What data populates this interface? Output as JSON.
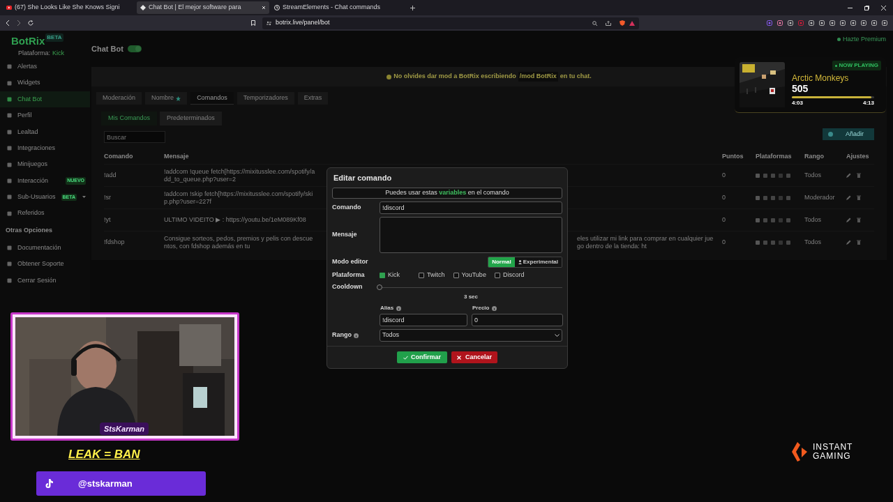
{
  "browser": {
    "tabs": [
      {
        "title": "(67) She Looks Like She Knows Signi",
        "selected": false,
        "kind": "video"
      },
      {
        "title": "Chat Bot | El mejor software para",
        "selected": true,
        "kind": "bot"
      },
      {
        "title": "StreamElements - Chat commands",
        "selected": false,
        "kind": "stream"
      }
    ],
    "url": "botrix.live/panel/bot"
  },
  "sidebar": {
    "logo": "BotRix",
    "beta": "BETA",
    "platform_label": "Plataforma:",
    "platform_value": "Kick",
    "items": [
      {
        "label": "Alertas",
        "selected": false
      },
      {
        "label": "Widgets",
        "selected": false
      },
      {
        "label": "Chat Bot",
        "selected": true
      },
      {
        "label": "Perfil",
        "selected": false
      },
      {
        "label": "Lealtad",
        "selected": false
      },
      {
        "label": "Integraciones",
        "selected": false
      },
      {
        "label": "Minijuegos",
        "selected": false
      },
      {
        "label": "Interacción",
        "selected": false,
        "badge": "NUEVO"
      },
      {
        "label": "Sub-Usuarios",
        "selected": false,
        "badge": "BETA",
        "expandable": true
      },
      {
        "label": "Referidos",
        "selected": false
      }
    ],
    "section_title": "Otras Opciones",
    "extra_items": [
      {
        "label": "Documentación",
        "selected": false
      },
      {
        "label": "Obtener Soporte",
        "selected": false
      },
      {
        "label": "Cerrar Sesión",
        "selected": false
      }
    ]
  },
  "premium_link": "Hazte Premium",
  "header": {
    "title": "Chat Bot",
    "bot_enabled": true
  },
  "banner": {
    "before": "No olvides dar mod a BotRix escribiendo",
    "command": "/mod BotRix",
    "after": "en tu chat."
  },
  "tabs": [
    {
      "label": "Moderación",
      "selected": false
    },
    {
      "label": "Nombre",
      "selected": false,
      "star": true
    },
    {
      "label": "Comandos",
      "selected": true
    },
    {
      "label": "Temporizadores",
      "selected": false
    },
    {
      "label": "Extras",
      "selected": false
    }
  ],
  "subtabs": [
    {
      "label": "Mis Comandos",
      "selected": true
    },
    {
      "label": "Predeterminados",
      "selected": false
    }
  ],
  "search": {
    "placeholder": "Buscar"
  },
  "add_button": "Añadir",
  "table": {
    "columns": [
      "Comando",
      "Mensaje",
      "Puntos",
      "Plataformas",
      "Rango",
      "Ajustes"
    ],
    "rows": [
      {
        "command": "!add",
        "message": "!addcom !queue fetch[https://mixitusslee.com/spotify/add_to_queue.php?user=2",
        "points": "0",
        "rank": "Todos"
      },
      {
        "command": "!sr",
        "message": "!addcom !skip fetch[https://mixitusslee.com/spotify/skip.php?user=227f",
        "points": "0",
        "rank": "Moderador"
      },
      {
        "command": "!yt",
        "message": "ULTIMO VIDEITO ▶ : https://youtu.be/1eM089Kf08",
        "points": "0",
        "rank": "Todos"
      },
      {
        "command": "!fdshop",
        "message": "Consigue sorteos, pedos, premios y pelis con descuentos, con fdshop además en tu",
        "message_tail": "eles utilizar mi link para comprar en cualquier juego dentro de la tienda: ht",
        "points": "0",
        "rank": "Todos"
      }
    ]
  },
  "dialog": {
    "title": "Editar comando",
    "info": "Puedes usar estas **variables** en el comando",
    "command_label": "Comando",
    "command_value": "!discord",
    "message_label": "Mensaje",
    "editor_label": "Modo editor",
    "editor_modes": [
      {
        "label": "Normal",
        "selected": true
      },
      {
        "label": "Experimental",
        "selected": false
      }
    ],
    "platform_label": "Plataforma",
    "platforms": [
      {
        "label": "Kick",
        "checked": true
      },
      {
        "label": "Twitch",
        "checked": false
      },
      {
        "label": "YouTube",
        "checked": false
      },
      {
        "label": "Discord",
        "checked": false
      }
    ],
    "cooldown_label": "Cooldown",
    "cooldown": {
      "level": 0,
      "reading": "3 sec"
    },
    "alias_label": "Alias",
    "alias_value": "!discord",
    "price_label": "Precio",
    "price_value": "0",
    "rank_label": "Rango",
    "rank_value": "Todos",
    "confirm": "Confirmar",
    "cancel": "Cancelar"
  },
  "now_playing": {
    "badge": "NOW PLAYING",
    "artist": "Arctic Monkeys",
    "song": "505",
    "level": 0.97,
    "elapsed": "4:03",
    "total": "4:13"
  },
  "stream": {
    "logo": "StsKarman",
    "leak": "LEAK = BAN",
    "tiktok": "@stskarman",
    "sponsor_top": "INSTANT",
    "sponsor_bottom": "GAMING"
  }
}
